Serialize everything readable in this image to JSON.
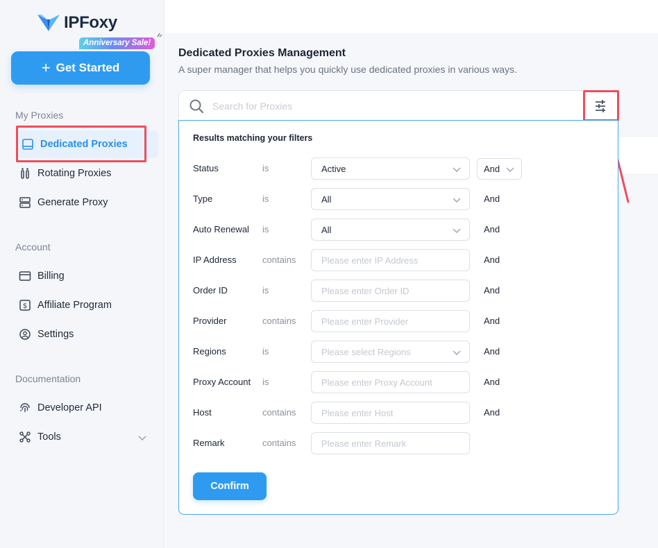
{
  "brand": {
    "name": "IPFoxy",
    "badge": "Anniversary Sale!"
  },
  "sidebar": {
    "cta_label": "Get Started",
    "sections": {
      "my_proxies": "My Proxies",
      "account": "Account",
      "documentation": "Documentation"
    },
    "items": {
      "dedicated": "Dedicated Proxies",
      "rotating": "Rotating Proxies",
      "generate": "Generate Proxy",
      "billing": "Billing",
      "affiliate": "Affiliate Program",
      "settings": "Settings",
      "developer_api": "Developer API",
      "tools": "Tools"
    }
  },
  "main": {
    "title": "Dedicated Proxies Management",
    "subtitle": "A super manager that helps you quickly use dedicated proxies in various ways.",
    "search_placeholder": "Search for Proxies"
  },
  "filters": {
    "title": "Results matching your filters",
    "rows": [
      {
        "label": "Status",
        "op": "is",
        "value": "Active",
        "placeholder": "",
        "and": "And"
      },
      {
        "label": "Type",
        "op": "is",
        "value": "All",
        "placeholder": "",
        "and": "And"
      },
      {
        "label": "Auto Renewal",
        "op": "is",
        "value": "All",
        "placeholder": "",
        "and": "And"
      },
      {
        "label": "IP Address",
        "op": "contains",
        "value": "",
        "placeholder": "Please enter IP Address",
        "and": "And"
      },
      {
        "label": "Order ID",
        "op": "is",
        "value": "",
        "placeholder": "Please enter Order ID",
        "and": "And"
      },
      {
        "label": "Provider",
        "op": "contains",
        "value": "",
        "placeholder": "Please enter Provider",
        "and": "And"
      },
      {
        "label": "Regions",
        "op": "is",
        "value": "",
        "placeholder": "Please select Regions",
        "and": "And"
      },
      {
        "label": "Proxy Account",
        "op": "is",
        "value": "",
        "placeholder": "Please enter Proxy Account",
        "and": "And"
      },
      {
        "label": "Host",
        "op": "contains",
        "value": "",
        "placeholder": "Please enter Host",
        "and": "And"
      },
      {
        "label": "Remark",
        "op": "contains",
        "value": "",
        "placeholder": "Please enter Remark",
        "and": ""
      }
    ],
    "confirm_label": "Confirm"
  },
  "colors": {
    "primary": "#2f9bf0",
    "highlight_red": "#ef4d5a",
    "active_bg": "#e6f1fd"
  }
}
